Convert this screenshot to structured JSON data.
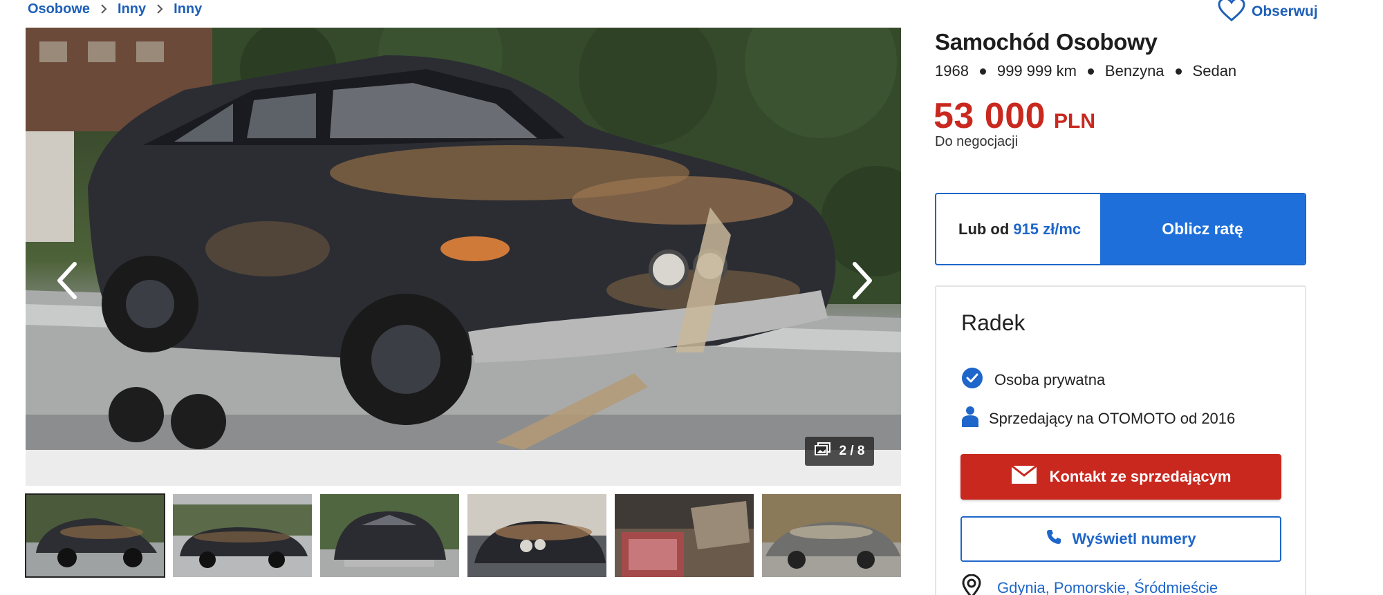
{
  "breadcrumb": [
    "Osobowe",
    "Inny",
    "Inny"
  ],
  "follow_label": "Obserwuj",
  "gallery": {
    "counter": "2 / 8",
    "thumbnail_count": 6,
    "active_thumbnail": 1
  },
  "listing": {
    "title": "Samochód Osobowy",
    "specs": [
      "1968",
      "999 999 km",
      "Benzyna",
      "Sedan"
    ],
    "price_amount": "53 000",
    "price_currency": "PLN",
    "price_note": "Do negocjacji"
  },
  "finance": {
    "prefix": "Lub od",
    "rate": "915 zł/mc",
    "button_label": "Oblicz ratę"
  },
  "seller": {
    "name": "Radek",
    "type": "Osoba prywatna",
    "since": "Sprzedający na OTOMOTO od 2016",
    "contact_button": "Kontakt ze sprzedającym",
    "phone_button": "Wyświetl numery",
    "location": "Gdynia, Pomorskie, Śródmieście"
  },
  "colors": {
    "brand_red": "#c9281f",
    "brand_blue": "#1e66c9",
    "link_blue": "#1e5fb8"
  }
}
